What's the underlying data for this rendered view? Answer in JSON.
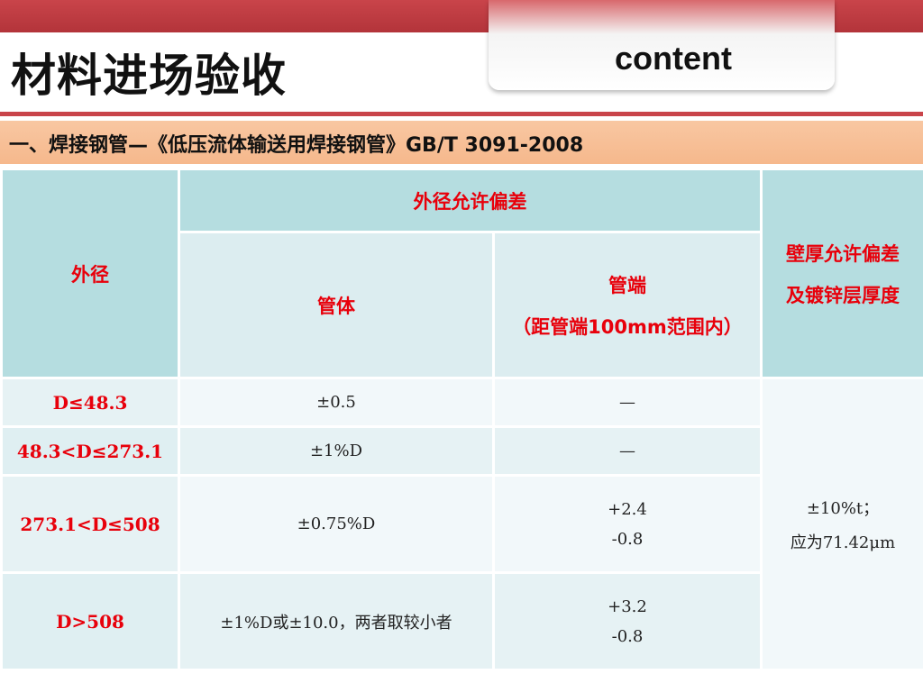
{
  "header": {
    "title": "材料进场验收",
    "tab_label": "content",
    "subtitle": "一、焊接钢管—《低压流体输送用焊接钢管》GB/T 3091-2008"
  },
  "table": {
    "col_outer_diameter": "外径",
    "col_od_tolerance": "外径允许偏差",
    "col_pipe_body": "管体",
    "col_pipe_end": "管端",
    "col_pipe_end_note": "（距管端100mm范围内）",
    "col_wall_line1": "壁厚允许偏差",
    "col_wall_line2": "及镀锌层厚度",
    "rows": [
      {
        "od": "D≤48.3",
        "body": "±0.5",
        "end_line1": "—",
        "end_line2": ""
      },
      {
        "od": "48.3<D≤273.1",
        "body": "±1%D",
        "end_line1": "—",
        "end_line2": ""
      },
      {
        "od": "273.1<D≤508",
        "body": "±0.75%D",
        "end_line1": "+2.4",
        "end_line2": "-0.8"
      },
      {
        "od": "D>508",
        "body": "±1%D或±10.0，两者取较小者",
        "end_line1": "+3.2",
        "end_line2": "-0.8"
      }
    ],
    "wall_value_line1": "±10%t；",
    "wall_value_line2": "应为71.42μm"
  },
  "colors": {
    "accent_red": "#c9444a",
    "header_text_red": "#e8000b",
    "table_header_teal": "#b5dde0",
    "subtitle_band": "#f6b88c"
  }
}
